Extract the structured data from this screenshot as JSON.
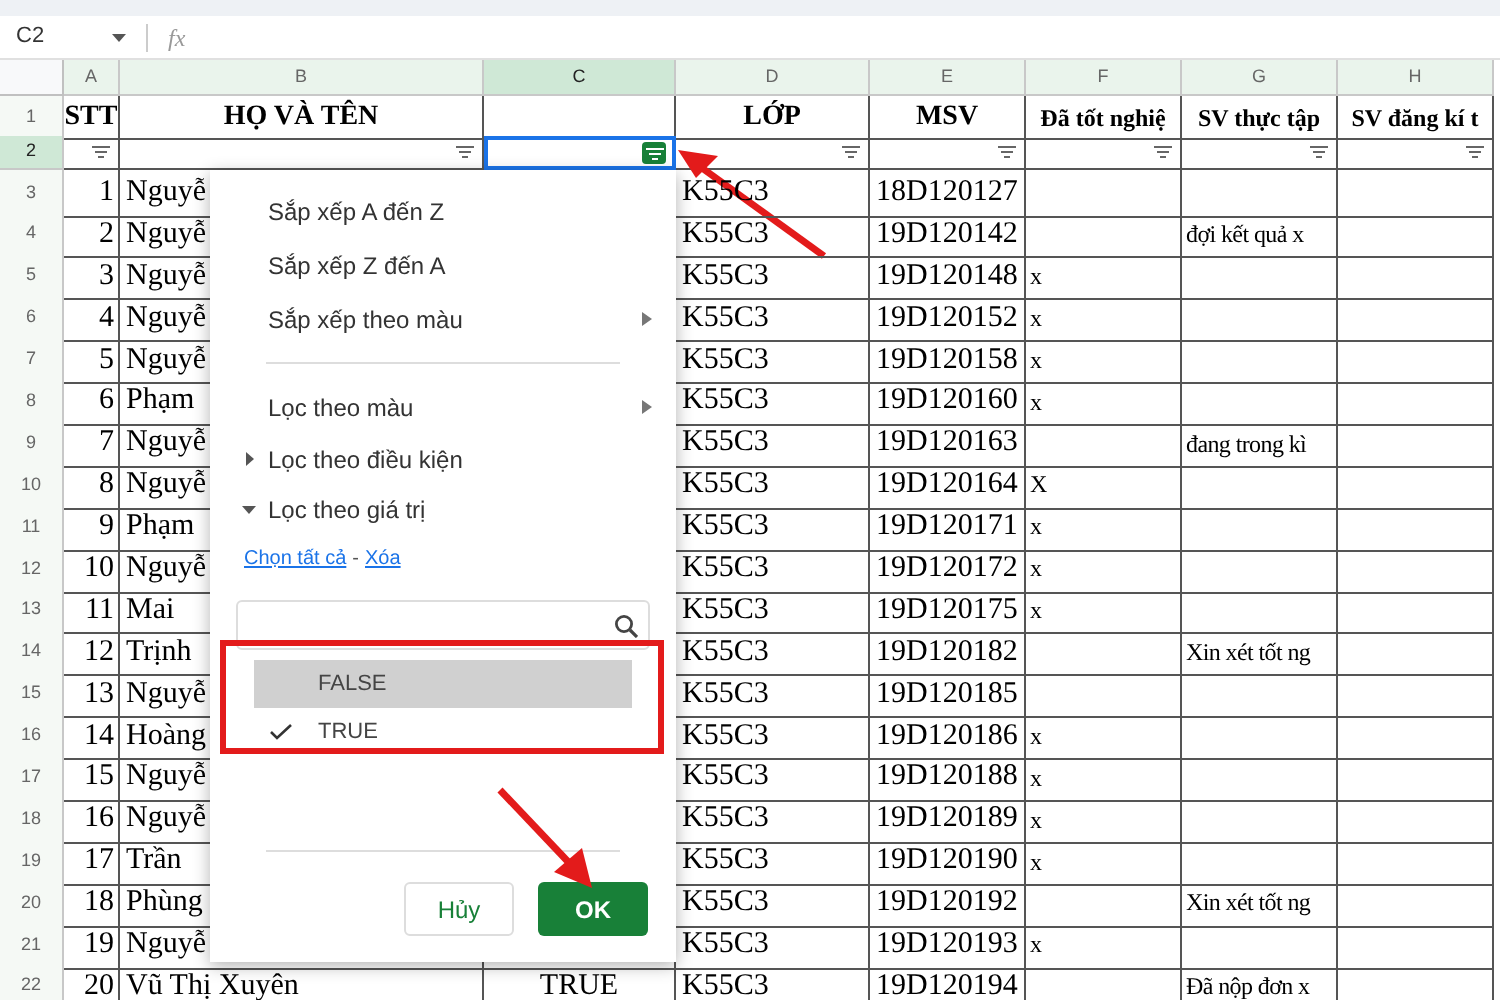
{
  "formula_bar": {
    "cell_ref": "C2",
    "fx": "fx"
  },
  "columns": [
    {
      "letter": "A",
      "header": "STT",
      "selected": false,
      "filter_active": false
    },
    {
      "letter": "B",
      "header": "HỌ VÀ TÊN",
      "selected": false,
      "filter_active": false
    },
    {
      "letter": "C",
      "selected": true,
      "filter_active": true
    },
    {
      "letter": "D",
      "header": "LỚP",
      "selected": false,
      "filter_active": false
    },
    {
      "letter": "E",
      "header": "MSV",
      "selected": false,
      "filter_active": false
    },
    {
      "letter": "F",
      "header": "Đã tốt nghiệ",
      "selected": false,
      "filter_active": false
    },
    {
      "letter": "G",
      "header": "SV thực tập",
      "selected": false,
      "filter_active": false
    },
    {
      "letter": "H",
      "header": "SV đăng kí t",
      "selected": false,
      "filter_active": false
    }
  ],
  "header_row": {
    "number": "1",
    "selected": false
  },
  "filter_row": {
    "number": "2",
    "selected": true
  },
  "rows": [
    {
      "number": "3",
      "selected": false,
      "stt": "1",
      "ho_ten": "Nguyễ",
      "lop": "K55C3",
      "msv": "18D120127"
    },
    {
      "number": "4",
      "selected": false,
      "stt": "2",
      "ho_ten": "Nguyễ",
      "lop": "K55C3",
      "msv": "19D120142",
      "sv_thuc_tap": "đợi kết quả x"
    },
    {
      "number": "5",
      "selected": false,
      "stt": "3",
      "ho_ten": "Nguyễ",
      "lop": "K55C3",
      "msv": "19D120148",
      "da_tot_nghiep": "x"
    },
    {
      "number": "6",
      "selected": false,
      "stt": "4",
      "ho_ten": "Nguyễ",
      "lop": "K55C3",
      "msv": "19D120152",
      "da_tot_nghiep": "x"
    },
    {
      "number": "7",
      "selected": false,
      "stt": "5",
      "ho_ten": "Nguyễ",
      "lop": "K55C3",
      "msv": "19D120158",
      "da_tot_nghiep": "x"
    },
    {
      "number": "8",
      "selected": false,
      "stt": "6",
      "ho_ten": "Phạm",
      "lop": "K55C3",
      "msv": "19D120160",
      "da_tot_nghiep": "x"
    },
    {
      "number": "9",
      "selected": false,
      "stt": "7",
      "ho_ten": "Nguyễ",
      "lop": "K55C3",
      "msv": "19D120163",
      "sv_thuc_tap": "đang trong kì"
    },
    {
      "number": "10",
      "selected": false,
      "stt": "8",
      "ho_ten": "Nguyễ",
      "lop": "K55C3",
      "msv": "19D120164",
      "da_tot_nghiep": "X"
    },
    {
      "number": "11",
      "selected": false,
      "stt": "9",
      "ho_ten": "Phạm",
      "lop": "K55C3",
      "msv": "19D120171",
      "da_tot_nghiep": "x"
    },
    {
      "number": "12",
      "selected": false,
      "stt": "10",
      "ho_ten": "Nguyễ",
      "lop": "K55C3",
      "msv": "19D120172",
      "da_tot_nghiep": "x"
    },
    {
      "number": "13",
      "selected": false,
      "stt": "11",
      "ho_ten": "Mai",
      "lop": "K55C3",
      "msv": "19D120175",
      "da_tot_nghiep": "x"
    },
    {
      "number": "14",
      "selected": false,
      "stt": "12",
      "ho_ten": "Trịnh",
      "lop": "K55C3",
      "msv": "19D120182",
      "sv_thuc_tap": "Xin xét tốt ng"
    },
    {
      "number": "15",
      "selected": false,
      "stt": "13",
      "ho_ten": "Nguyễ",
      "lop": "K55C3",
      "msv": "19D120185"
    },
    {
      "number": "16",
      "selected": false,
      "stt": "14",
      "ho_ten": "Hoàng",
      "lop": "K55C3",
      "msv": "19D120186",
      "da_tot_nghiep": "x"
    },
    {
      "number": "17",
      "selected": false,
      "stt": "15",
      "ho_ten": "Nguyễ",
      "lop": "K55C3",
      "msv": "19D120188",
      "da_tot_nghiep": "x"
    },
    {
      "number": "18",
      "selected": false,
      "stt": "16",
      "ho_ten": "Nguyễ",
      "lop": "K55C3",
      "msv": "19D120189",
      "da_tot_nghiep": "x"
    },
    {
      "number": "19",
      "selected": false,
      "stt": "17",
      "ho_ten": "Trần",
      "lop": "K55C3",
      "msv": "19D120190",
      "da_tot_nghiep": "x"
    },
    {
      "number": "20",
      "selected": false,
      "stt": "18",
      "ho_ten": "Phùng",
      "lop": "K55C3",
      "msv": "19D120192",
      "sv_thuc_tap": "Xin xét tốt ng"
    },
    {
      "number": "21",
      "selected": false,
      "stt": "19",
      "ho_ten": "Nguyễ",
      "lop": "K55C3",
      "msv": "19D120193",
      "da_tot_nghiep": "x"
    },
    {
      "number": "22",
      "selected": false,
      "stt": "20",
      "ho_ten": "Vũ Thị Xuyên",
      "col_c": "TRUE",
      "lop": "K55C3",
      "msv": "19D120194",
      "sv_thuc_tap": "Đã nộp đơn x"
    }
  ],
  "filter_menu": {
    "items": [
      {
        "kind": "action",
        "label": "Sắp xếp A đến Z"
      },
      {
        "kind": "action",
        "label": "Sắp xếp Z đến A"
      },
      {
        "kind": "submenu",
        "label": "Sắp xếp theo màu"
      },
      {
        "kind": "divider"
      },
      {
        "kind": "submenu",
        "label": "Lọc theo màu"
      },
      {
        "kind": "section",
        "label": "Lọc theo điều kiện",
        "expanded": false
      },
      {
        "kind": "section",
        "label": "Lọc theo giá trị",
        "expanded": true
      }
    ],
    "select_all": "Chọn tất cả",
    "separator": "-",
    "clear": "Xóa",
    "values": [
      {
        "label": "FALSE",
        "checked": false,
        "highlighted": true
      },
      {
        "label": "TRUE",
        "checked": true,
        "highlighted": false
      }
    ],
    "cancel": "Hủy",
    "ok": "OK"
  }
}
